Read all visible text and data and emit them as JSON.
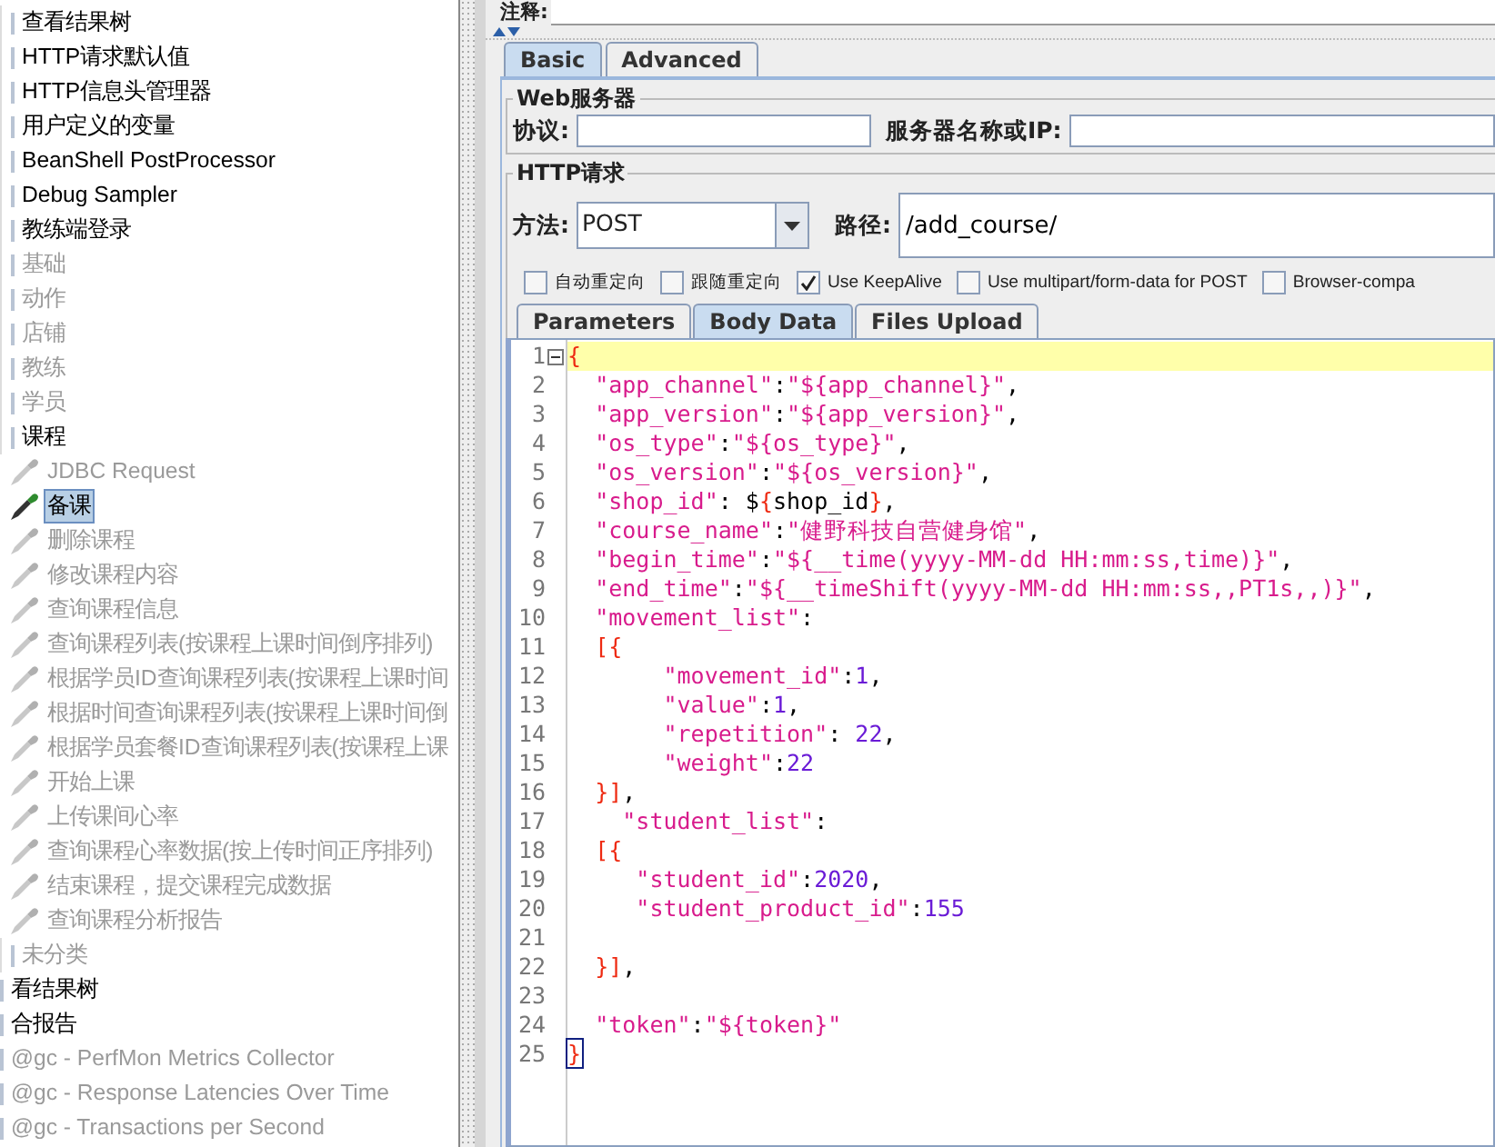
{
  "tree": {
    "items": [
      {
        "children": [
          {
            "label": "查看结果树",
            "kind": "element",
            "disabled": false,
            "selected": false
          },
          {
            "label": "HTTP请求默认值",
            "kind": "element",
            "disabled": false,
            "selected": false
          },
          {
            "label": "HTTP信息头管理器",
            "kind": "element",
            "disabled": false,
            "selected": false
          },
          {
            "label": "用户定义的变量",
            "kind": "element",
            "disabled": false,
            "selected": false
          },
          {
            "label": "BeanShell PostProcessor",
            "kind": "element",
            "disabled": false,
            "selected": false
          },
          {
            "label": "Debug Sampler",
            "kind": "element",
            "disabled": false,
            "selected": false
          },
          {
            "label": "教练端登录",
            "kind": "element",
            "disabled": false,
            "selected": false
          },
          {
            "label": "基础",
            "kind": "element",
            "disabled": true,
            "selected": false
          },
          {
            "label": "动作",
            "kind": "element",
            "disabled": true,
            "selected": false
          },
          {
            "label": "店铺",
            "kind": "element",
            "disabled": true,
            "selected": false
          },
          {
            "label": "教练",
            "kind": "element",
            "disabled": true,
            "selected": false
          },
          {
            "label": "学员",
            "kind": "element",
            "disabled": true,
            "selected": false
          },
          {
            "label": "课程",
            "kind": "element",
            "disabled": false,
            "selected": false,
            "children": [
              {
                "label": "JDBC Request",
                "kind": "sampler",
                "disabled": true,
                "selected": false
              },
              {
                "label": "备课",
                "kind": "sampler",
                "disabled": false,
                "selected": true
              },
              {
                "label": "删除课程",
                "kind": "sampler",
                "disabled": true,
                "selected": false
              },
              {
                "label": "修改课程内容",
                "kind": "sampler",
                "disabled": true,
                "selected": false
              },
              {
                "label": "查询课程信息",
                "kind": "sampler",
                "disabled": true,
                "selected": false
              },
              {
                "label": "查询课程列表(按课程上课时间倒序排列)",
                "kind": "sampler",
                "disabled": true,
                "selected": false
              },
              {
                "label": "根据学员ID查询课程列表(按课程上课时间",
                "kind": "sampler",
                "disabled": true,
                "selected": false
              },
              {
                "label": "根据时间查询课程列表(按课程上课时间倒",
                "kind": "sampler",
                "disabled": true,
                "selected": false
              },
              {
                "label": "根据学员套餐ID查询课程列表(按课程上课",
                "kind": "sampler",
                "disabled": true,
                "selected": false
              },
              {
                "label": "开始上课",
                "kind": "sampler",
                "disabled": true,
                "selected": false
              },
              {
                "label": "上传课间心率",
                "kind": "sampler",
                "disabled": true,
                "selected": false
              },
              {
                "label": "查询课程心率数据(按上传时间正序排列)",
                "kind": "sampler",
                "disabled": true,
                "selected": false
              },
              {
                "label": "结束课程，提交课程完成数据",
                "kind": "sampler",
                "disabled": true,
                "selected": false
              },
              {
                "label": "查询课程分析报告",
                "kind": "sampler",
                "disabled": true,
                "selected": false
              }
            ]
          },
          {
            "label": "未分类",
            "kind": "element",
            "disabled": true,
            "selected": false
          }
        ]
      },
      {
        "label": "看结果树",
        "kind": "element",
        "disabled": false,
        "selected": false
      },
      {
        "label": "合报告",
        "kind": "element",
        "disabled": false,
        "selected": false
      },
      {
        "label": "@gc - PerfMon Metrics Collector",
        "kind": "element",
        "disabled": true,
        "selected": false
      },
      {
        "label": "@gc - Response Latencies Over Time",
        "kind": "element",
        "disabled": true,
        "selected": false
      },
      {
        "label": "@gc - Transactions per Second",
        "kind": "element",
        "disabled": true,
        "selected": false
      }
    ]
  },
  "comment": {
    "label": "注释:"
  },
  "tabs": [
    {
      "label": "Basic",
      "selected": true
    },
    {
      "label": "Advanced",
      "selected": false
    }
  ],
  "web_server": {
    "title": "Web服务器",
    "protocol_label": "协议:",
    "server_label": "服务器名称或IP:"
  },
  "http_request": {
    "title": "HTTP请求",
    "method_label": "方法:",
    "method": "POST",
    "path_label": "路径:",
    "path": "/add_course/",
    "options": [
      {
        "label": "自动重定向",
        "checked": false
      },
      {
        "label": "跟随重定向",
        "checked": false
      },
      {
        "label": "Use KeepAlive",
        "checked": true
      },
      {
        "label": "Use multipart/form-data for POST",
        "checked": false
      },
      {
        "label": "Browser-compa",
        "checked": false
      }
    ]
  },
  "sub_tabs": [
    {
      "label": "Parameters",
      "selected": false
    },
    {
      "label": "Body Data",
      "selected": true
    },
    {
      "label": "Files Upload",
      "selected": false
    }
  ],
  "editor": {
    "lines": [
      {
        "number": "1",
        "text": "{",
        "current": true,
        "foldable": true,
        "bracket_match": false
      },
      {
        "number": "2",
        "text": "  \"app_channel\":\"${app_channel}\",",
        "current": false,
        "foldable": false,
        "bracket_match": false
      },
      {
        "number": "3",
        "text": "  \"app_version\":\"${app_version}\",",
        "current": false,
        "foldable": false,
        "bracket_match": false
      },
      {
        "number": "4",
        "text": "  \"os_type\":\"${os_type}\",",
        "current": false,
        "foldable": false,
        "bracket_match": false
      },
      {
        "number": "5",
        "text": "  \"os_version\":\"${os_version}\",",
        "current": false,
        "foldable": false,
        "bracket_match": false
      },
      {
        "number": "6",
        "text": "  \"shop_id\": ${shop_id},",
        "current": false,
        "foldable": false,
        "bracket_match": false
      },
      {
        "number": "7",
        "text": "  \"course_name\":\"健野科技自营健身馆\",",
        "current": false,
        "foldable": false,
        "bracket_match": false
      },
      {
        "number": "8",
        "text": "  \"begin_time\":\"${__time(yyyy-MM-dd HH:mm:ss,time)}\",",
        "current": false,
        "foldable": false,
        "bracket_match": false
      },
      {
        "number": "9",
        "text": "  \"end_time\":\"${__timeShift(yyyy-MM-dd HH:mm:ss,,PT1s,,)}\",",
        "current": false,
        "foldable": false,
        "bracket_match": false
      },
      {
        "number": "10",
        "text": "  \"movement_list\":",
        "current": false,
        "foldable": false,
        "bracket_match": false
      },
      {
        "number": "11",
        "text": "  [{",
        "current": false,
        "foldable": false,
        "bracket_match": false
      },
      {
        "number": "12",
        "text": "       \"movement_id\":1,",
        "current": false,
        "foldable": false,
        "bracket_match": false
      },
      {
        "number": "13",
        "text": "       \"value\":1,",
        "current": false,
        "foldable": false,
        "bracket_match": false
      },
      {
        "number": "14",
        "text": "       \"repetition\": 22,",
        "current": false,
        "foldable": false,
        "bracket_match": false
      },
      {
        "number": "15",
        "text": "       \"weight\":22",
        "current": false,
        "foldable": false,
        "bracket_match": false
      },
      {
        "number": "16",
        "text": "  }],",
        "current": false,
        "foldable": false,
        "bracket_match": false
      },
      {
        "number": "17",
        "text": "    \"student_list\":",
        "current": false,
        "foldable": false,
        "bracket_match": false
      },
      {
        "number": "18",
        "text": "  [{",
        "current": false,
        "foldable": false,
        "bracket_match": false
      },
      {
        "number": "19",
        "text": "     \"student_id\":2020,",
        "current": false,
        "foldable": false,
        "bracket_match": false
      },
      {
        "number": "20",
        "text": "     \"student_product_id\":155",
        "current": false,
        "foldable": false,
        "bracket_match": false
      },
      {
        "number": "21",
        "current": false,
        "foldable": false,
        "bracket_match": false
      },
      {
        "number": "22",
        "text": "  }],",
        "current": false,
        "foldable": false,
        "bracket_match": false
      },
      {
        "number": "23",
        "current": false,
        "foldable": false,
        "bracket_match": false
      },
      {
        "number": "24",
        "text": "  \"token\":\"${token}\"",
        "current": false,
        "foldable": false,
        "bracket_match": false
      },
      {
        "number": "25",
        "text": "}",
        "current": false,
        "foldable": false,
        "bracket_match": true
      }
    ]
  }
}
